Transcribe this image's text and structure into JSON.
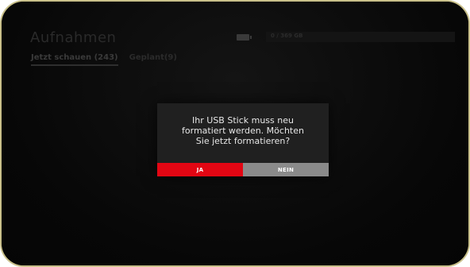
{
  "header": {
    "title": "Aufnahmen"
  },
  "tabs": [
    {
      "label": "Jetzt schauen (243)"
    },
    {
      "label": "Geplant(9)"
    }
  ],
  "storage": {
    "icon": "battery-icon",
    "text": "0 / 369 GB",
    "used_fraction": 0.0
  },
  "dialog": {
    "message": "Ihr USB Stick muss neu formatiert werden. Möchten Sie jetzt formatieren?",
    "yes_label": "JA",
    "no_label": "NEIN"
  },
  "colors": {
    "yes_button": "#e30613",
    "no_button": "#8a8a8a",
    "dialog_bg": "#202020",
    "screen_bg": "#0d0d0d"
  }
}
